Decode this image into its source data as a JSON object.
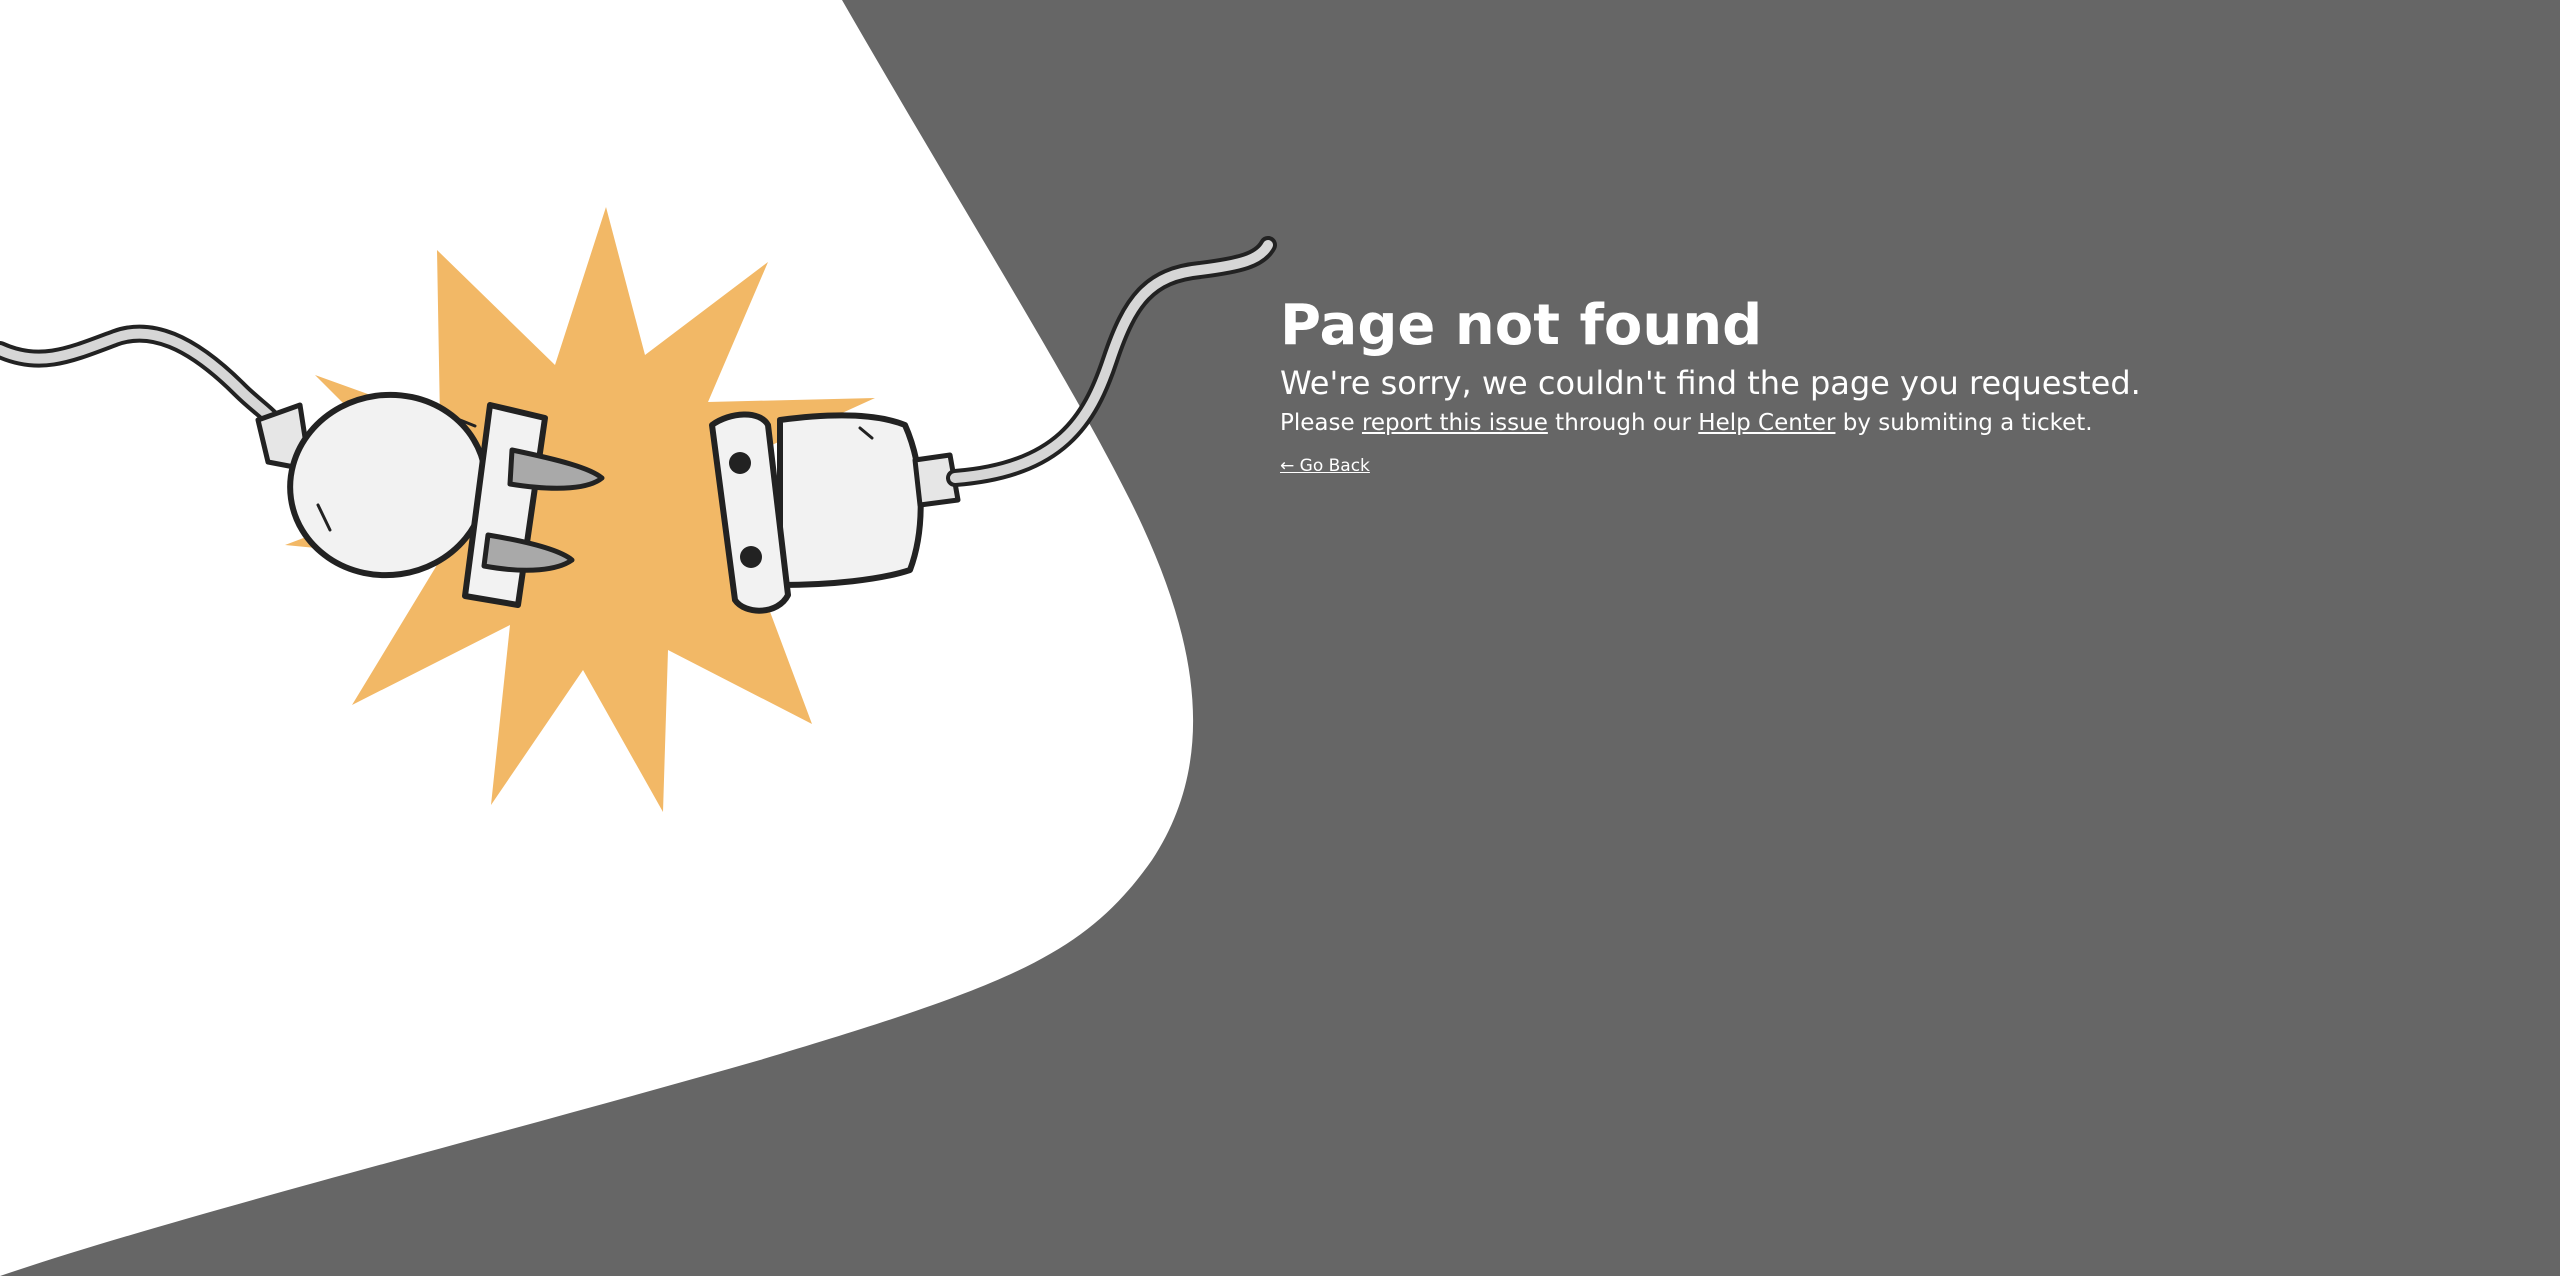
{
  "page": {
    "title": "Page not found",
    "subtitle": "We're sorry, we couldn't find the page you requested.",
    "help": {
      "prefix": "Please ",
      "report_link": "report this issue",
      "middle": " through our ",
      "help_center_link": "Help Center",
      "suffix": " by submiting a ticket."
    },
    "back_link": "← Go Back"
  },
  "colors": {
    "background": "#666666",
    "panel": "#ffffff",
    "burst": "#F2B866",
    "text": "#ffffff"
  },
  "illustration": {
    "icons": [
      "unplugged-plug-icon",
      "socket-plug-icon",
      "spark-burst-icon"
    ]
  }
}
